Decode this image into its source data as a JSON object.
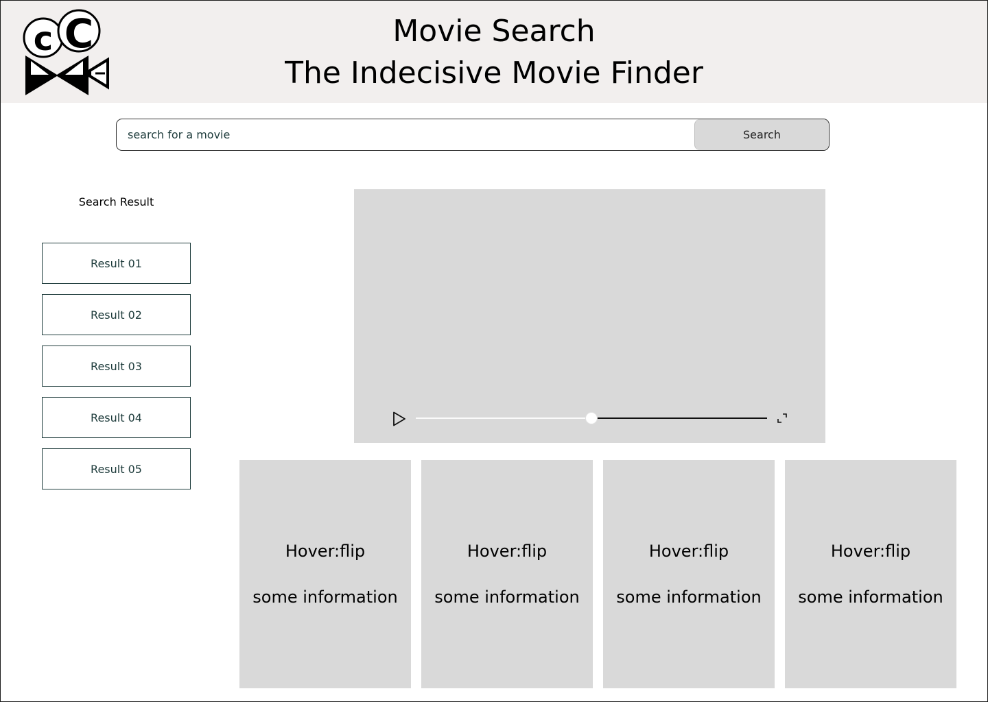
{
  "header": {
    "logo": "cinema-camera-logo",
    "title": "Movie Search",
    "subtitle": "The Indecisive Movie Finder",
    "background": "#f2efee"
  },
  "search": {
    "placeholder": "search for a movie",
    "value": "",
    "button_label": "Search"
  },
  "results": {
    "title": "Search Result",
    "items": [
      {
        "label": "Result 01"
      },
      {
        "label": "Result 02"
      },
      {
        "label": "Result 03"
      },
      {
        "label": "Result 04"
      },
      {
        "label": "Result 05"
      }
    ]
  },
  "video": {
    "play_icon": "play-icon",
    "fullscreen_icon": "fullscreen-icon",
    "progress": 0.5
  },
  "cards": [
    {
      "front": "Hover:flip",
      "info": "some information"
    },
    {
      "front": "Hover:flip",
      "info": "some information"
    },
    {
      "front": "Hover:flip",
      "info": "some information"
    },
    {
      "front": "Hover:flip",
      "info": "some information"
    }
  ],
  "colors": {
    "placeholder_bg": "#d9d9d9",
    "accent_text": "#1d3b3b"
  }
}
